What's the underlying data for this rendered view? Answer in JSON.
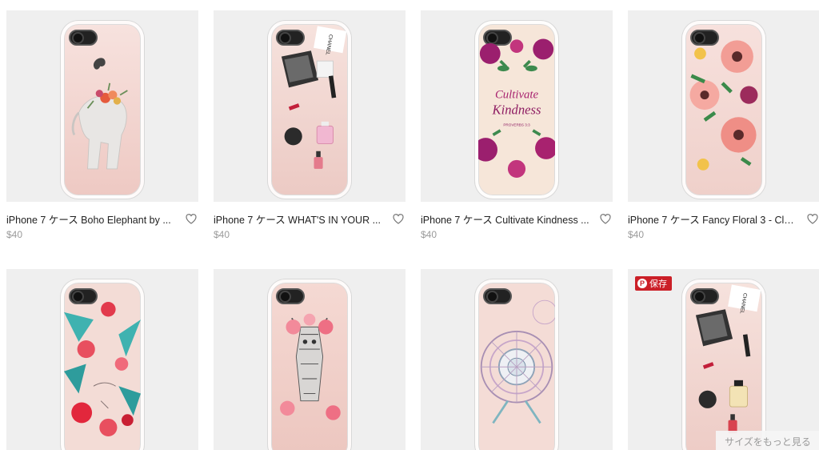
{
  "products": [
    {
      "title": "iPhone 7 ケース Boho Elephant by ...",
      "price": "$40",
      "case_color": "#f3d3cf",
      "art": "elephant"
    },
    {
      "title": "iPhone 7 ケース WHAT'S IN YOUR ...",
      "price": "$40",
      "case_color": "#f1d4cf",
      "art": "bag"
    },
    {
      "title": "iPhone 7 ケース Cultivate Kindness ...",
      "price": "$40",
      "case_color": "#f0dccf",
      "art": "kindness"
    },
    {
      "title": "iPhone 7 ケース Fancy Floral 3 - Cla...",
      "price": "$40",
      "case_color": "#f2d7d2",
      "art": "floral"
    }
  ],
  "products_row2": [
    {
      "art": "tropical"
    },
    {
      "art": "giraffe"
    },
    {
      "art": "mandala"
    },
    {
      "art": "bag2"
    }
  ],
  "case_texts": {
    "cultivate": "Cultivate",
    "kindness": "Kindness",
    "proverbs": "PROVERBS 3:3",
    "chanel": "CHANEL"
  },
  "save_badge": {
    "icon": "pinterest-icon",
    "label": "保存"
  },
  "see_larger": "サイズをもっと見る",
  "colors": {
    "tile_bg": "#efefef",
    "price": "#9a9a9a",
    "save_red": "#cb1f27"
  }
}
